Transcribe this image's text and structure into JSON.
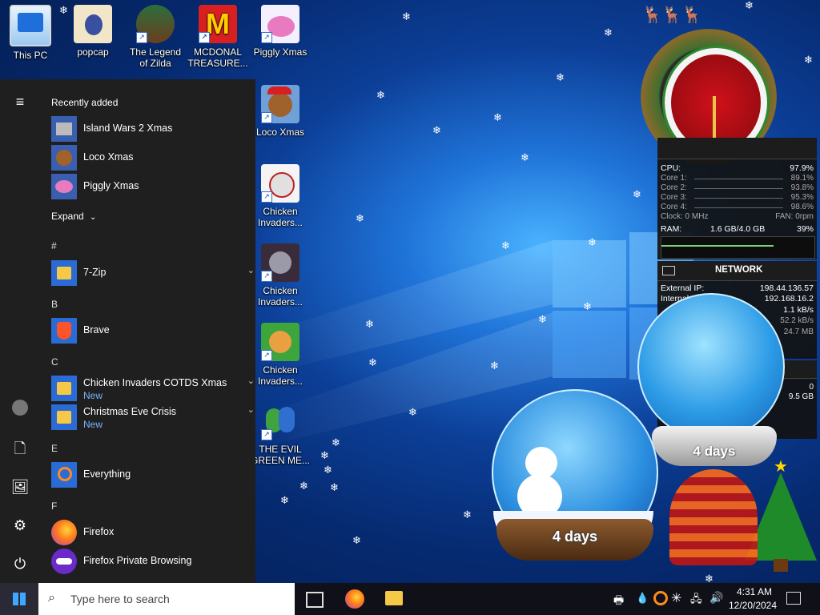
{
  "desktop": {
    "icons": [
      {
        "label_1": "This PC",
        "label_2": ""
      },
      {
        "label_1": "popcap",
        "label_2": ""
      },
      {
        "label_1": "The Legend",
        "label_2": "of Zilda"
      },
      {
        "label_1": "MCDONAL",
        "label_2": "TREASURE..."
      },
      {
        "label_1": "Piggly Xmas",
        "label_2": ""
      },
      {
        "label_1": "Loco Xmas",
        "label_2": ""
      },
      {
        "label_1": "Chicken",
        "label_2": "Invaders..."
      },
      {
        "label_1": "Chicken",
        "label_2": "Invaders..."
      },
      {
        "label_1": "Chicken",
        "label_2": "Invaders..."
      },
      {
        "label_1": "THE EVIL",
        "label_2": "GREEN ME..."
      }
    ]
  },
  "start_menu": {
    "recently_added_label": "Recently added",
    "recent": [
      {
        "label": "Island Wars 2 Xmas"
      },
      {
        "label": "Loco Xmas"
      },
      {
        "label": "Piggly Xmas"
      }
    ],
    "expand_label": "Expand",
    "groups": {
      "hash": "#",
      "b": "B",
      "c": "C",
      "e": "E",
      "f": "F"
    },
    "apps": [
      {
        "label": "7-Zip",
        "sub": ""
      },
      {
        "label": "Brave",
        "sub": ""
      },
      {
        "label": "Chicken Invaders COTDS Xmas",
        "sub": "New"
      },
      {
        "label": "Christmas Eve Crisis",
        "sub": "New"
      },
      {
        "label": "Everything",
        "sub": ""
      },
      {
        "label": "Firefox",
        "sub": ""
      },
      {
        "label": "Firefox Private Browsing",
        "sub": ""
      }
    ]
  },
  "taskbar": {
    "search_placeholder": "Type here to search",
    "time": "4:31 AM",
    "date": "12/20/2024"
  },
  "cpu_gadget": {
    "cpu_label": "CPU:",
    "cpu_value": "97.9%",
    "cores": [
      {
        "label": "Core 1:",
        "value": "89.1%"
      },
      {
        "label": "Core 2:",
        "value": "93.8%"
      },
      {
        "label": "Core 3:",
        "value": "95.3%"
      },
      {
        "label": "Core 4:",
        "value": "98.6%"
      }
    ],
    "clock": "Clock: 0 MHz",
    "fan": "FAN: 0rpm",
    "ram_label": "RAM:",
    "ram_value": "1.6 GB/4.0 GB",
    "ram_pct": "39%"
  },
  "network_gadget": {
    "title": "NETWORK",
    "external_ip_label": "External IP:",
    "external_ip": "198.44.136.57",
    "internal_label": "Internal",
    "internal_ip": "192.168.16.2",
    "rate_1": "1.1 kB/s",
    "rate_2": "52.2 kB/s",
    "total": "24.7 MB"
  },
  "drive_gadget": {
    "value_1": "0",
    "value_2": "9.5 GB"
  },
  "globes": {
    "left_caption": "4 days",
    "right_caption": "4 days"
  }
}
